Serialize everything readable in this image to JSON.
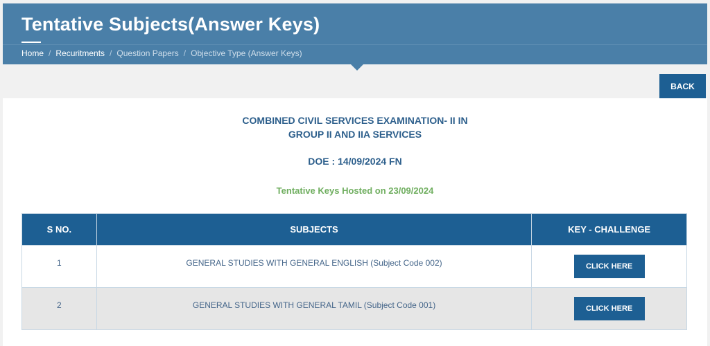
{
  "header": {
    "title": "Tentative Subjects(Answer Keys)",
    "breadcrumb": [
      {
        "label": "Home"
      },
      {
        "label": "Recuritments"
      },
      {
        "label": "Question Papers"
      },
      {
        "label": "Objective Type (Answer Keys)"
      }
    ]
  },
  "back_label": "BACK",
  "exam": {
    "title_line1": "COMBINED CIVIL SERVICES EXAMINATION- II IN",
    "title_line2": "GROUP II AND IIA SERVICES",
    "doe": "DOE : 14/09/2024 FN",
    "hosted": "Tentative Keys Hosted on 23/09/2024"
  },
  "table": {
    "headers": {
      "sno": "S NO.",
      "subjects": "SUBJECTS",
      "key": "KEY - CHALLENGE"
    },
    "rows": [
      {
        "sno": "1",
        "subject": "GENERAL STUDIES WITH GENERAL ENGLISH (Subject Code 002)",
        "action": "CLICK HERE"
      },
      {
        "sno": "2",
        "subject": "GENERAL STUDIES WITH GENERAL TAMIL (Subject Code 001)",
        "action": "CLICK HERE"
      }
    ]
  },
  "colors": {
    "header_bg": "#4a7fa8",
    "primary": "#1d5f93",
    "text_blue": "#2d5f8c",
    "hosted_green": "#6fae5f"
  }
}
